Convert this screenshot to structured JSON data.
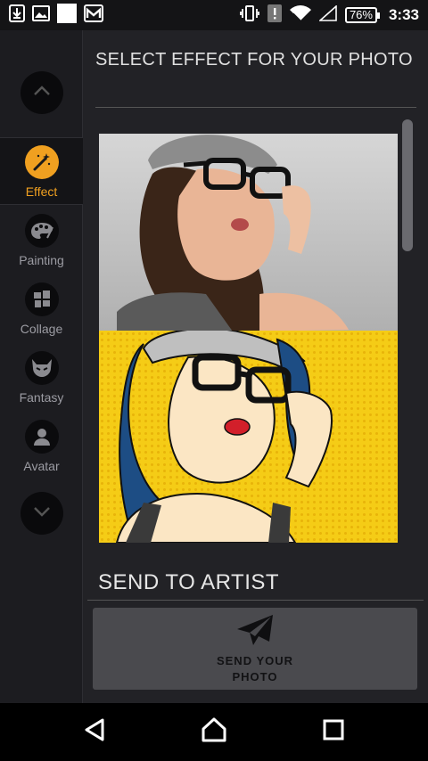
{
  "status_bar": {
    "battery": "76%",
    "time": "3:33",
    "icons": [
      "download-icon",
      "image-icon",
      "blank-icon",
      "gmail-icon",
      "vibrate-icon",
      "alert-icon",
      "wifi-icon",
      "signal-icon"
    ]
  },
  "sidebar": {
    "up_button_icon": "chevron-up-icon",
    "down_button_icon": "chevron-down-icon",
    "items": [
      {
        "label": "Effect",
        "icon": "magic-wand-icon",
        "active": true
      },
      {
        "label": "Painting",
        "icon": "palette-icon",
        "active": false
      },
      {
        "label": "Collage",
        "icon": "collage-icon",
        "active": false
      },
      {
        "label": "Fantasy",
        "icon": "fantasy-mask-icon",
        "active": false
      },
      {
        "label": "Avatar",
        "icon": "avatar-icon",
        "active": false
      }
    ]
  },
  "main": {
    "title": "SELECT EFFECT FOR YOUR PHOTO",
    "preview_images": [
      "original-photo",
      "pop-art-effect-photo"
    ],
    "send_section_title": "SEND TO ARTIST",
    "send_button_label": "SEND YOUR PHOTO",
    "send_button_icon": "paper-plane-icon"
  },
  "navigation": {
    "back_icon": "back-icon",
    "home_icon": "home-icon",
    "recents_icon": "recents-icon"
  },
  "colors": {
    "accent": "#f0a020",
    "background": "#222226",
    "sidebar": "#1c1c20",
    "button": "#4a4a4e",
    "popart_yellow": "#f5cc16"
  }
}
